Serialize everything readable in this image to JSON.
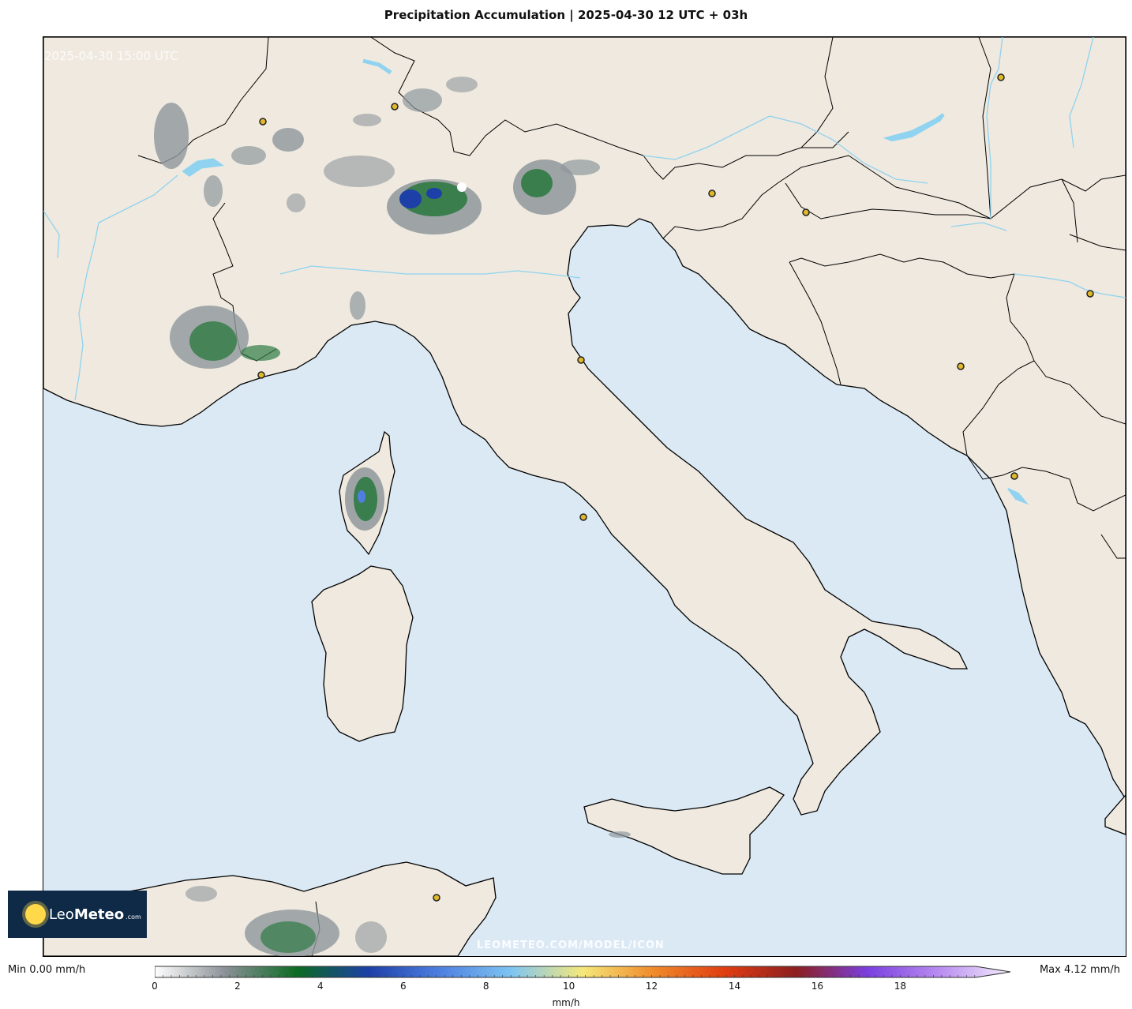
{
  "title": "Precipitation Accumulation | 2025-04-30 12 UTC + 03h",
  "map": {
    "timestamp": "2025-04-30 15:00 UTC",
    "watermark": "LEOMETEO.COM/MODEL/ICON",
    "colors": {
      "land": "#efe9df",
      "sea": "#dbe9f5",
      "rivers": "#8fd3f0",
      "coast": "#000000",
      "city": "#e0b92a"
    }
  },
  "logo": {
    "leo": "Leo",
    "meteo": "Meteo",
    "com": ".com"
  },
  "legend": {
    "min_label": "Min 0.00 mm/h",
    "max_label": "Max 4.12 mm/h",
    "unit": "mm/h",
    "ticks": [
      "0",
      "2",
      "4",
      "6",
      "8",
      "10",
      "12",
      "14",
      "16",
      "18"
    ],
    "tick_values": [
      0,
      2,
      4,
      6,
      8,
      10,
      12,
      14,
      16,
      18
    ],
    "range": [
      0,
      20.7
    ],
    "stops": [
      "#ffffff",
      "#8a9096",
      "#0b6b22",
      "#1d3fa8",
      "#4e7fe0",
      "#7ec5f2",
      "#f5e87a",
      "#f08a2a",
      "#e03c12",
      "#8c1f1f",
      "#7a3fe0",
      "#b98cf0",
      "#f4eefc"
    ]
  }
}
